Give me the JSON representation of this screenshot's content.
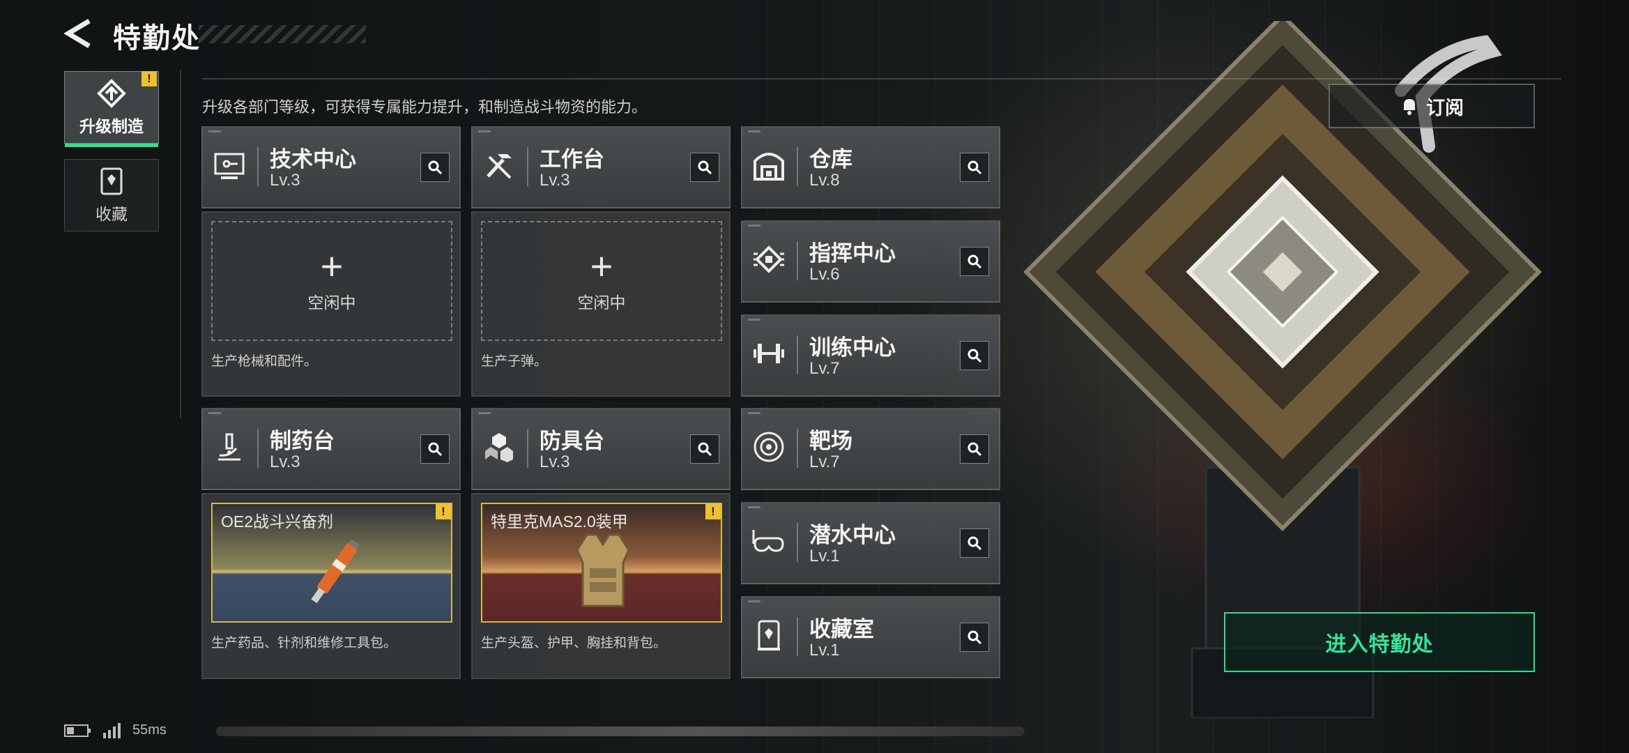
{
  "header": {
    "title": "特勤处"
  },
  "sidebar": {
    "items": [
      {
        "label": "升级制造",
        "active": true,
        "badge": "!"
      },
      {
        "label": "收藏",
        "active": false
      }
    ]
  },
  "description": "升级各部门等级，可获得专属能力提升，和制造战斗物资的能力。",
  "subscribe": {
    "label": "订阅",
    "icon": "bell-icon"
  },
  "departments": [
    {
      "name": "技术中心",
      "level": "Lv.3",
      "icon": "tech-center-icon"
    },
    {
      "name": "工作台",
      "level": "Lv.3",
      "icon": "workbench-icon"
    },
    {
      "name": "仓库",
      "level": "Lv.8",
      "icon": "warehouse-icon"
    },
    {
      "name": "指挥中心",
      "level": "Lv.6",
      "icon": "command-center-icon"
    },
    {
      "name": "训练中心",
      "level": "Lv.7",
      "icon": "training-center-icon"
    },
    {
      "name": "制药台",
      "level": "Lv.3",
      "icon": "pharmacy-icon"
    },
    {
      "name": "防具台",
      "level": "Lv.3",
      "icon": "armor-bench-icon"
    },
    {
      "name": "靶场",
      "level": "Lv.7",
      "icon": "shooting-range-icon"
    },
    {
      "name": "潜水中心",
      "level": "Lv.1",
      "icon": "diving-center-icon"
    },
    {
      "name": "收藏室",
      "level": "Lv.1",
      "icon": "collection-room-icon"
    }
  ],
  "slots": {
    "tech": {
      "status": "空闲中",
      "desc": "生产枪械和配件。"
    },
    "workbench": {
      "status": "空闲中",
      "desc": "生产子弹。"
    },
    "pharmacy": {
      "product": "OE2战斗兴奋剂",
      "desc": "生产药品、针剂和维修工具包。",
      "badge": "!"
    },
    "armor": {
      "product": "特里克MAS2.0装甲",
      "desc": "生产头盔、护甲、胸挂和背包。",
      "badge": "!"
    }
  },
  "enter_button": {
    "label": "进入特勤处"
  },
  "status_bar": {
    "ping": "55ms"
  },
  "colors": {
    "accent": "#2ee08c",
    "warning": "#f0c030"
  }
}
